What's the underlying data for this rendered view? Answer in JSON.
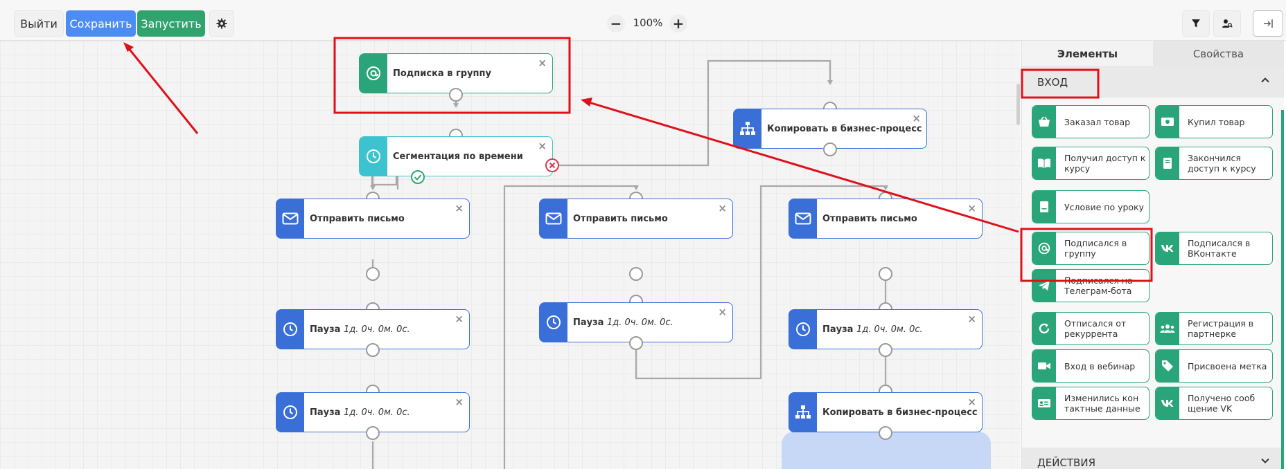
{
  "toolbar": {
    "exit_label": "Выйти",
    "save_label": "Сохранить",
    "run_label": "Запустить",
    "zoom_value": "100%"
  },
  "nodes": {
    "subscribe": "Подписка в группу",
    "segment": "Сегментация по времени",
    "copy_top": "Копировать в бизнес-процесс",
    "send1": "Отправить письмо",
    "send2": "Отправить письмо",
    "send3": "Отправить письмо",
    "pause_label": "Пауза",
    "pause_value": "1д. 0ч. 0м. 0с.",
    "copy_bottom": "Копировать в бизнес-процесс",
    "close_glyph": "×"
  },
  "panel": {
    "tab_elements": "Элементы",
    "tab_properties": "Свойства",
    "section_input": "ВХОД",
    "section_actions": "ДЕЙСТВИЯ",
    "tiles": [
      {
        "label": "Заказал товар",
        "icon": "basket-icon"
      },
      {
        "label": "Купил товар",
        "icon": "money-icon"
      },
      {
        "label": "Получил доступ к курсу",
        "icon": "book-icon"
      },
      {
        "label": "Закончился доступ к курсу",
        "icon": "book-closed-icon"
      },
      {
        "label": "Условие по уроку",
        "icon": "lesson-icon"
      },
      {
        "label": "Подписался в группу",
        "icon": "at-icon"
      },
      {
        "label": "Подписался в ВКонтакте",
        "icon": "vk-icon"
      },
      {
        "label": "Подписался на Телеграм-бота",
        "icon": "telegram-icon"
      },
      {
        "label": "Отписался от рекуррента",
        "icon": "refresh-icon"
      },
      {
        "label": "Регистрация в партнерке",
        "icon": "users-icon"
      },
      {
        "label": "Вход в вебинар",
        "icon": "video-icon"
      },
      {
        "label": "Присвоена метка",
        "icon": "tag-icon"
      },
      {
        "label": "Изменились кон тактные данные",
        "icon": "contact-card-icon"
      },
      {
        "label": "Получено сооб щение VK",
        "icon": "vk-icon"
      }
    ]
  },
  "colors": {
    "blue_node": "#3a6fd8",
    "green": "#2aa57a",
    "teal": "#3cc3cf",
    "save_button": "#4d8cf5",
    "annotation_red": "#e0101a"
  }
}
